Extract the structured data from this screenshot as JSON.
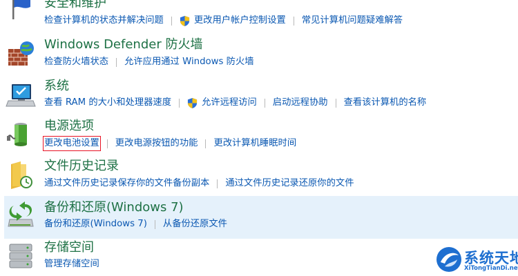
{
  "sections": [
    {
      "title": "安全和维护",
      "links": [
        "检查计算机的状态并解决问题",
        "更改用户帐户控制设置",
        "常见计算机问题疑难解答"
      ]
    },
    {
      "title": "Windows Defender 防火墙",
      "links": [
        "检查防火墙状态",
        "允许应用通过 Windows 防火墙"
      ]
    },
    {
      "title": "系统",
      "links": [
        "查看 RAM 的大小和处理器速度",
        "允许远程访问",
        "启动远程协助",
        "查看该计算机的名称"
      ]
    },
    {
      "title": "电源选项",
      "links": [
        "更改电池设置",
        "更改电源按钮的功能",
        "更改计算机睡眠时间"
      ]
    },
    {
      "title": "文件历史记录",
      "links": [
        "通过文件历史记录保存你的文件备份副本",
        "通过文件历史记录还原你的文件"
      ]
    },
    {
      "title": "备份和还原(Windows 7)",
      "links": [
        "备份和还原(Windows 7)",
        "从备份还原文件"
      ]
    },
    {
      "title": "存储空间",
      "links": [
        "管理存储空间"
      ]
    }
  ],
  "watermark": {
    "text": "系统天地",
    "url": "XiTongTianDi.net"
  },
  "colors": {
    "title": "#1e7145",
    "link": "#0b58b2",
    "highlight_row": "#e5f1fb",
    "selection_box": "#e81123"
  },
  "icons": [
    "flag-icon",
    "firewall-icon",
    "computer-icon",
    "battery-icon",
    "file-history-icon",
    "backup-icon",
    "storage-icon",
    "shield-icon"
  ]
}
